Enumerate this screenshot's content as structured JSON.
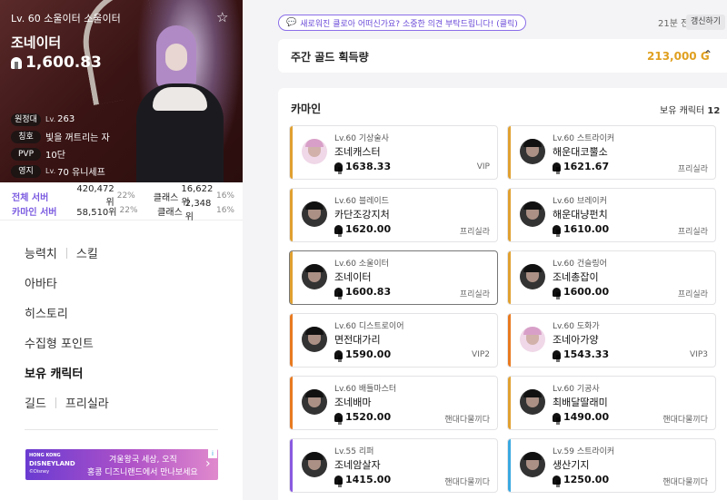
{
  "profile": {
    "level_line": "Lv. 60 소울이터 소울이터",
    "name": "조네이터",
    "item_level": "1,600.83",
    "info": [
      {
        "tag": "원정대",
        "prefix": "Lv.",
        "value": "263"
      },
      {
        "tag": "칭호",
        "prefix": "",
        "value": "빛을 꺼트리는 자"
      },
      {
        "tag": "PVP",
        "prefix": "",
        "value": "10단"
      },
      {
        "tag": "영지",
        "prefix": "Lv.",
        "value": "70 유니세프"
      }
    ],
    "ranks": [
      {
        "server": "전체 서버",
        "rank": "420,472위",
        "pct": "22%",
        "class_label": "클래스",
        "class_rank": "16,622위",
        "class_pct": "16%"
      },
      {
        "server": "카마인 서버",
        "rank": "58,510위",
        "pct": "22%",
        "class_label": "클래스",
        "class_rank": "2,348위",
        "class_pct": "16%"
      }
    ]
  },
  "menu": {
    "row1_a": "능력치",
    "row1_b": "스킬",
    "avatar": "아바타",
    "history": "히스토리",
    "collect": "수집형 포인트",
    "roster": "보유 캐릭터",
    "row6_a": "길드",
    "row6_b": "프리실라"
  },
  "ad": {
    "logo_top": "HONG KONG",
    "logo_main": "DISNEYLAND",
    "logo_small": "©Disney",
    "line1": "겨울왕국 세상, 오직",
    "line2": "홍콩 디즈니랜드에서 만나보세요",
    "badge": "i"
  },
  "topbar": {
    "feedback": "새로워진 클로아 어떠신가요? 소중한 의견 부탁드립니다! (클릭)",
    "ago": "21분 전",
    "refresh": "갱신하기"
  },
  "gold": {
    "label": "주간 골드 획득량",
    "amount": "213,000 G"
  },
  "roster": {
    "title": "카마인",
    "count_label": "보유 캐릭터",
    "count": "12",
    "cards": [
      {
        "lv": "Lv.60 기상술사",
        "name": "조네캐스터",
        "ilvl": "1638.33",
        "tag": "VIP",
        "color": "#e0a030"
      },
      {
        "lv": "Lv.60 스트라이커",
        "name": "해운대코뿔소",
        "ilvl": "1621.67",
        "tag": "프리실라",
        "color": "#e0a030"
      },
      {
        "lv": "Lv.60 블레이드",
        "name": "카단조강지처",
        "ilvl": "1620.00",
        "tag": "프리실라",
        "color": "#e0a030"
      },
      {
        "lv": "Lv.60 브레이커",
        "name": "해운대냥펀치",
        "ilvl": "1610.00",
        "tag": "프리실라",
        "color": "#e0a030"
      },
      {
        "lv": "Lv.60 소울이터",
        "name": "조네이터",
        "ilvl": "1600.83",
        "tag": "프리실라",
        "color": "#e0a030"
      },
      {
        "lv": "Lv.60 건슬링어",
        "name": "조네총잡이",
        "ilvl": "1600.00",
        "tag": "프리실라",
        "color": "#e0a030"
      },
      {
        "lv": "Lv.60 디스트로이어",
        "name": "면전대가리",
        "ilvl": "1590.00",
        "tag": "VIP2",
        "color": "#e87a20"
      },
      {
        "lv": "Lv.60 도화가",
        "name": "조네아가양",
        "ilvl": "1543.33",
        "tag": "VIP3",
        "color": "#e87a20"
      },
      {
        "lv": "Lv.60 배틀마스터",
        "name": "조네배마",
        "ilvl": "1520.00",
        "tag": "핸대다물끼다",
        "color": "#e87a20"
      },
      {
        "lv": "Lv.60 기공사",
        "name": "최배달딸래미",
        "ilvl": "1490.00",
        "tag": "핸대다물끼다",
        "color": "#e0a030"
      },
      {
        "lv": "Lv.55 리퍼",
        "name": "조네암살자",
        "ilvl": "1415.00",
        "tag": "핸대다물끼다",
        "color": "#8a5ae0"
      },
      {
        "lv": "Lv.59 스트라이커",
        "name": "생산기지",
        "ilvl": "1250.00",
        "tag": "핸대다물끼다",
        "color": "#3aa8e0"
      }
    ]
  },
  "colors": {
    "accent": "#7a5ae0",
    "gold": "#e0a020"
  }
}
